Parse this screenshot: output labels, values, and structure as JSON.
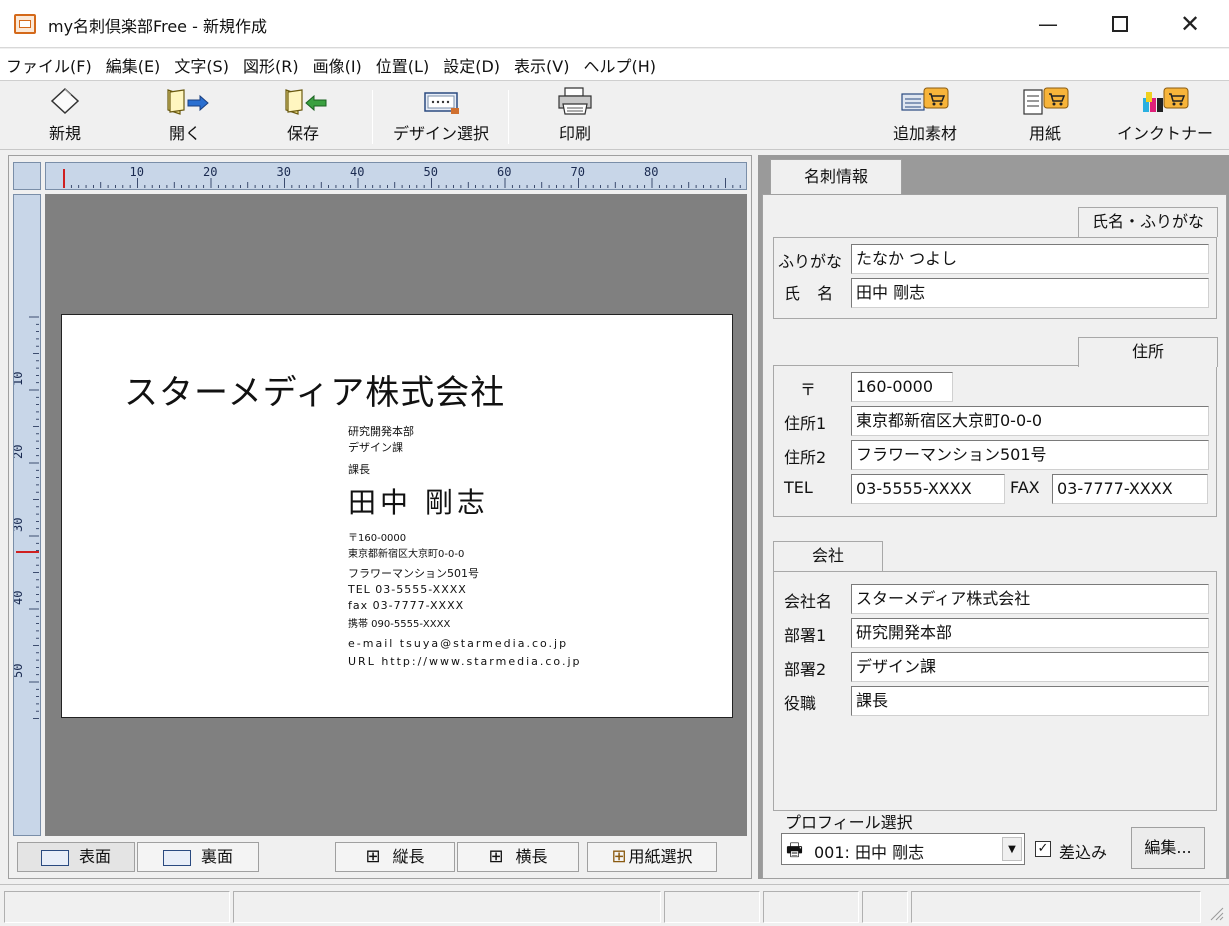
{
  "window": {
    "title": "my名刺倶楽部Free - 新規作成",
    "minimize_icon": "minimize-icon",
    "maximize_icon": "maximize-icon",
    "close_icon": "close-icon"
  },
  "menu": [
    "ファイル(F)",
    "編集(E)",
    "文字(S)",
    "図形(R)",
    "画像(I)",
    "位置(L)",
    "設定(D)",
    "表示(V)",
    "ヘルプ(H)"
  ],
  "toolbar": {
    "new": "新規",
    "open": "開く",
    "save": "保存",
    "design": "デザイン選択",
    "print": "印刷",
    "materials": "追加素材",
    "paper": "用紙",
    "ink": "インクトナー"
  },
  "ruler": {
    "top_labels": [
      "10",
      "20",
      "30",
      "40",
      "50",
      "60",
      "70",
      "80"
    ],
    "left_labels": [
      "10",
      "20",
      "30",
      "40",
      "50"
    ]
  },
  "card": {
    "company": "スターメディア株式会社",
    "dept1": "研究開発本部",
    "dept2": "デザイン課",
    "title": "課長",
    "name": "田中 剛志",
    "postal": "〒160-0000",
    "address1": "東京都新宿区大京町0-0-0",
    "address2": "フラワーマンション501号",
    "tel": "TEL 03-5555-XXXX",
    "fax": "fax 03-7777-XXXX",
    "mobile": "携帯 090-5555-XXXX",
    "email": "e-mail tsuya@starmedia.co.jp",
    "url": "URL http://www.starmedia.co.jp"
  },
  "doc_tabs": {
    "front": "表面",
    "back": "裏面",
    "vertical": "縦長",
    "horizontal": "横長",
    "paper_select": "用紙選択"
  },
  "info": {
    "tab": "名刺情報",
    "name_group": {
      "label": "氏名・ふりがな",
      "furigana_label": "ふりがな",
      "furigana_value": "たなか つよし",
      "name_label": "氏 名",
      "name_value": "田中 剛志"
    },
    "address_group": {
      "label": "住所",
      "postal_label": "〒",
      "postal_value": "160-0000",
      "addr1_label": "住所1",
      "addr1_value": "東京都新宿区大京町0-0-0",
      "addr2_label": "住所2",
      "addr2_value": "フラワーマンション501号",
      "tel_label": "TEL",
      "tel_value": "03-5555-XXXX",
      "fax_label": "FAX",
      "fax_value": "03-7777-XXXX"
    },
    "company_group": {
      "label": "会社",
      "company_label": "会社名",
      "company_value": "スターメディア株式会社",
      "dept1_label": "部署1",
      "dept1_value": "研究開発本部",
      "dept2_label": "部署2",
      "dept2_value": "デザイン課",
      "position_label": "役職",
      "position_value": "課長"
    },
    "profile": {
      "label": "プロフィール選択",
      "selected": "001: 田中 剛志",
      "merge_label": "差込み",
      "merge_checked": true,
      "edit_button": "編集..."
    }
  }
}
